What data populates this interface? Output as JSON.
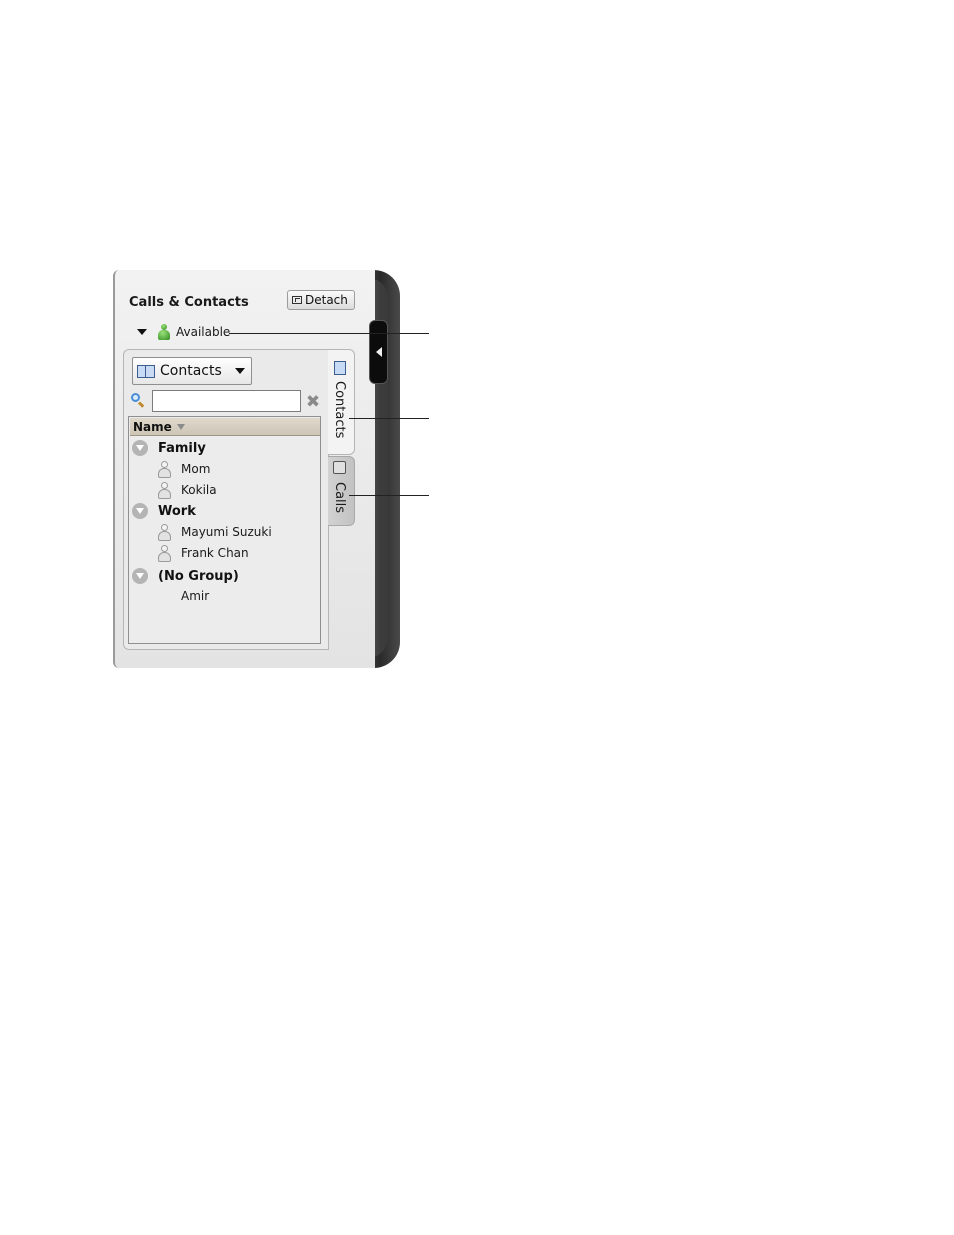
{
  "window": {
    "title": "Calls & Contacts",
    "detach_label": "Detach"
  },
  "status": {
    "label": "Available",
    "icon": "person-icon-green"
  },
  "contacts_dropdown": {
    "selected": "Contacts"
  },
  "search": {
    "value": "",
    "placeholder": ""
  },
  "list": {
    "header": "Name",
    "groups": [
      {
        "label": "Family",
        "contacts": [
          "Mom",
          "Kokila"
        ]
      },
      {
        "label": "Work",
        "contacts": [
          "Mayumi Suzuki",
          "Frank Chan"
        ]
      },
      {
        "label": "(No Group)",
        "contacts": [
          "Amir"
        ]
      }
    ]
  },
  "tabs": {
    "contacts": "Contacts",
    "calls": "Calls"
  },
  "colors": {
    "status_green": "#3aa02a",
    "frame_dark": "#2a2a2a",
    "panel_bg": "#eaeaea"
  }
}
